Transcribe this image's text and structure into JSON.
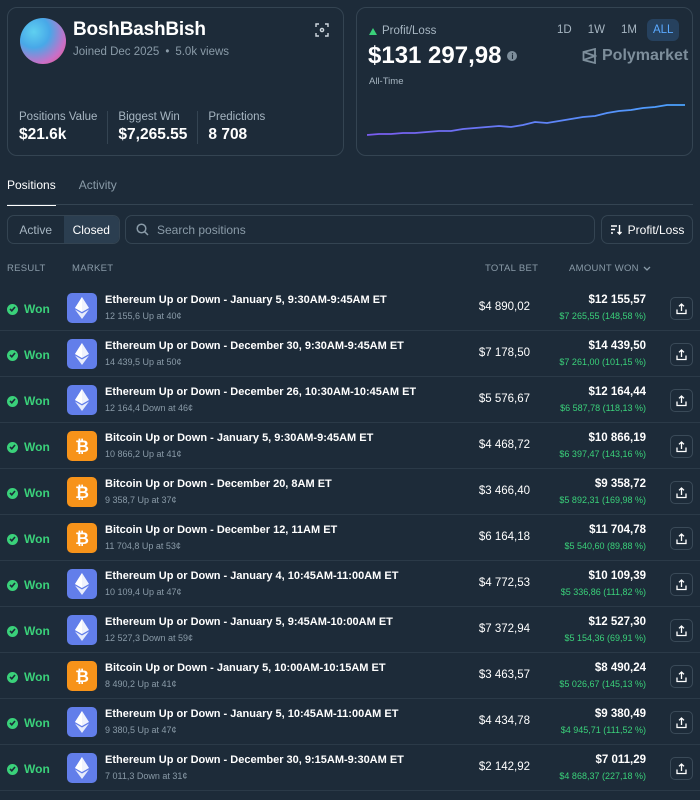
{
  "profile": {
    "username": "BoshBashBish",
    "joined": "Joined Dec 2025",
    "views": "5.0k views",
    "stats": [
      {
        "label": "Positions Value",
        "value": "$21.6k"
      },
      {
        "label": "Biggest Win",
        "value": "$7,265.55"
      },
      {
        "label": "Predictions",
        "value": "8 708"
      }
    ]
  },
  "pnl": {
    "label": "Profit/Loss",
    "value": "$131 297,98",
    "period": "All-Time",
    "ranges": [
      "1D",
      "1W",
      "1M",
      "ALL"
    ],
    "active_range": "ALL",
    "brand": "Polymarket",
    "line_colors": [
      "#7b5cf0",
      "#4aa3ff"
    ]
  },
  "tabs": {
    "positions": "Positions",
    "activity": "Activity"
  },
  "filters": {
    "active": "Active",
    "closed": "Closed"
  },
  "search": {
    "placeholder": "Search positions"
  },
  "sort": {
    "label": "Profit/Loss"
  },
  "columns": {
    "result": "RESULT",
    "market": "MARKET",
    "total": "TOTAL BET",
    "amount": "AMOUNT WON"
  },
  "rows": [
    {
      "result": "Won",
      "coin": "eth",
      "title": "Ethereum Up or Down - January 5, 9:30AM-9:45AM ET",
      "sub": "12 155,6 Up at 40¢",
      "total": "$4 890,02",
      "amount": "$12 155,57",
      "pnl": "$7 265,55 (148,58 %)"
    },
    {
      "result": "Won",
      "coin": "eth",
      "title": "Ethereum Up or Down - December 30, 9:30AM-9:45AM ET",
      "sub": "14 439,5 Up at 50¢",
      "total": "$7 178,50",
      "amount": "$14 439,50",
      "pnl": "$7 261,00 (101,15 %)"
    },
    {
      "result": "Won",
      "coin": "eth",
      "title": "Ethereum Up or Down - December 26, 10:30AM-10:45AM ET",
      "sub": "12 164,4 Down at 46¢",
      "total": "$5 576,67",
      "amount": "$12 164,44",
      "pnl": "$6 587,78 (118,13 %)"
    },
    {
      "result": "Won",
      "coin": "btc",
      "title": "Bitcoin Up or Down - January 5, 9:30AM-9:45AM ET",
      "sub": "10 866,2 Up at 41¢",
      "total": "$4 468,72",
      "amount": "$10 866,19",
      "pnl": "$6 397,47 (143,16 %)"
    },
    {
      "result": "Won",
      "coin": "btc",
      "title": "Bitcoin Up or Down - December 20, 8AM ET",
      "sub": "9 358,7 Up at 37¢",
      "total": "$3 466,40",
      "amount": "$9 358,72",
      "pnl": "$5 892,31 (169,98 %)"
    },
    {
      "result": "Won",
      "coin": "btc",
      "title": "Bitcoin Up or Down - December 12, 11AM ET",
      "sub": "11 704,8 Up at 53¢",
      "total": "$6 164,18",
      "amount": "$11 704,78",
      "pnl": "$5 540,60 (89,88 %)"
    },
    {
      "result": "Won",
      "coin": "eth",
      "title": "Ethereum Up or Down - January 4, 10:45AM-11:00AM ET",
      "sub": "10 109,4 Up at 47¢",
      "total": "$4 772,53",
      "amount": "$10 109,39",
      "pnl": "$5 336,86 (111,82 %)"
    },
    {
      "result": "Won",
      "coin": "eth",
      "title": "Ethereum Up or Down - January 5, 9:45AM-10:00AM ET",
      "sub": "12 527,3 Down at 59¢",
      "total": "$7 372,94",
      "amount": "$12 527,30",
      "pnl": "$5 154,36 (69,91 %)"
    },
    {
      "result": "Won",
      "coin": "btc",
      "title": "Bitcoin Up or Down - January 5, 10:00AM-10:15AM ET",
      "sub": "8 490,2 Up at 41¢",
      "total": "$3 463,57",
      "amount": "$8 490,24",
      "pnl": "$5 026,67 (145,13 %)"
    },
    {
      "result": "Won",
      "coin": "eth",
      "title": "Ethereum Up or Down - January 5, 10:45AM-11:00AM ET",
      "sub": "9 380,5 Up at 47¢",
      "total": "$4 434,78",
      "amount": "$9 380,49",
      "pnl": "$4 945,71 (111,52 %)"
    },
    {
      "result": "Won",
      "coin": "eth",
      "title": "Ethereum Up or Down - December 30, 9:15AM-9:30AM ET",
      "sub": "7 011,3 Down at 31¢",
      "total": "$2 142,92",
      "amount": "$7 011,29",
      "pnl": "$4 868,37 (227,18 %)"
    }
  ]
}
